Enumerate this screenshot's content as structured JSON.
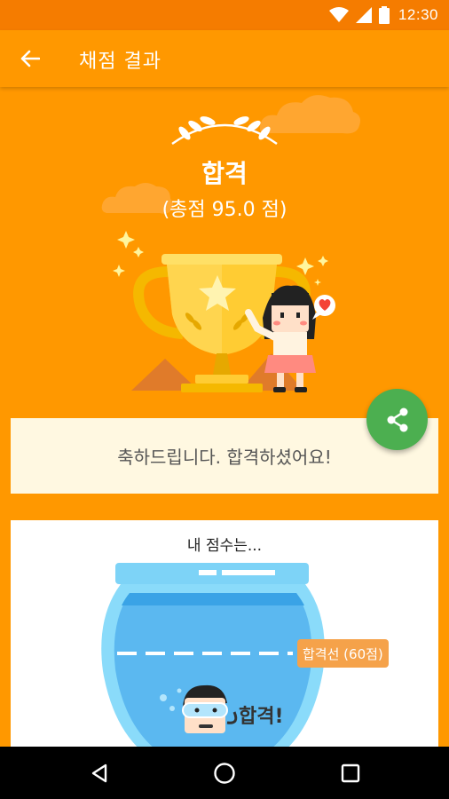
{
  "status_bar": {
    "time": "12:30"
  },
  "app_bar": {
    "title": "채점 결과",
    "back_icon": "arrow-left-icon"
  },
  "hero": {
    "result": "합격",
    "score": "(총점 95.0 점)"
  },
  "congrats": {
    "message": "축하드립니다. 합격하셨어요!"
  },
  "share_button": {
    "icon": "share-icon",
    "color": "#4CAF50"
  },
  "score_card": {
    "title": "내 점수는...",
    "pass_line_label": "합격선 (60점)",
    "result_badge": "합격!"
  },
  "colors": {
    "primary": "#FF9800",
    "primary_dark": "#F57C00",
    "card_cream": "#FFF8E1",
    "water": "#5BB8F0"
  }
}
